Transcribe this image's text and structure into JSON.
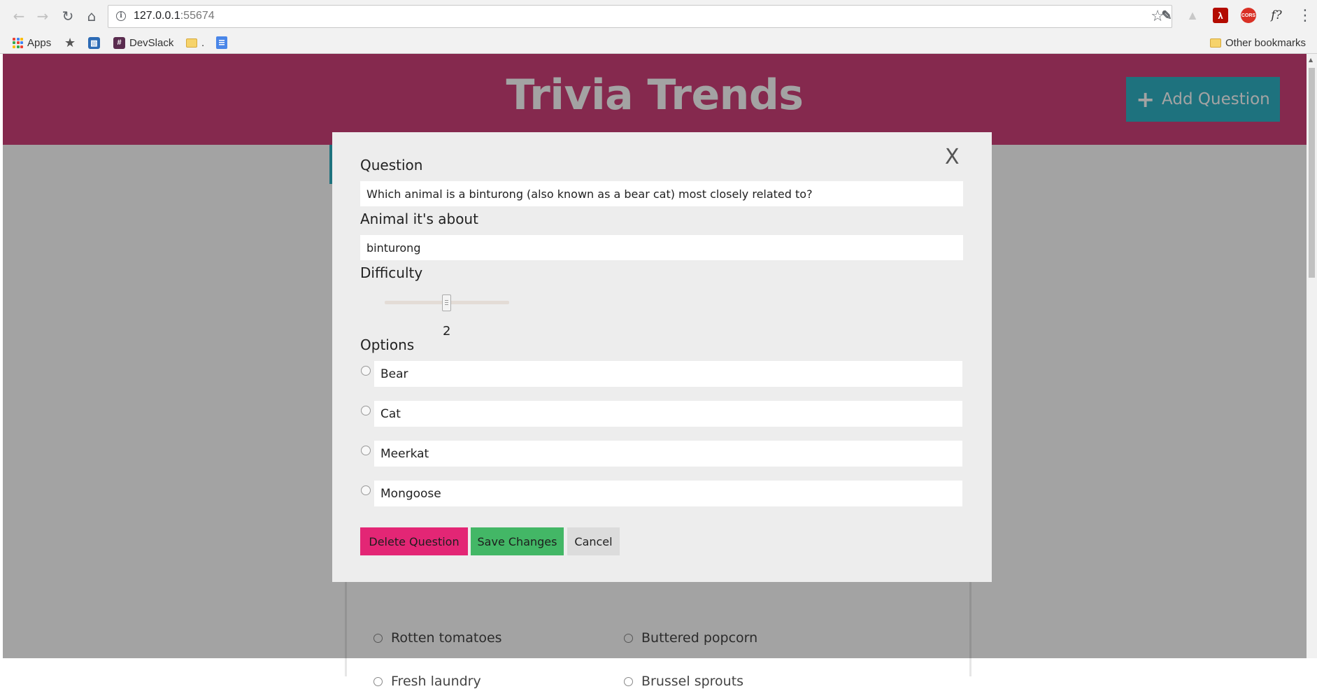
{
  "browser": {
    "url_host": "127.0.0.1",
    "url_port": ":55674",
    "bookmarks": {
      "apps": "Apps",
      "devslack": "DevSlack",
      "dot_folder": ".",
      "other": "Other bookmarks"
    },
    "extensions": [
      "eyedropper-icon",
      "drive-icon",
      "pdf-icon",
      "cors-icon",
      "formula-icon"
    ],
    "ext_labels": {
      "cors": "CORS",
      "formula": "f?"
    }
  },
  "header": {
    "title": "Trivia Trends",
    "add_button": "Add Question",
    "colors": {
      "bar": "#d1417a",
      "button": "#2fb3c6"
    }
  },
  "background_card": {
    "options": [
      "Rotten tomatoes",
      "Buttered popcorn",
      "Fresh laundry",
      "Brussel sprouts"
    ]
  },
  "modal": {
    "close_label": "X",
    "question_label": "Question",
    "question_value": "Which animal is a binturong (also known as a bear cat) most closely related to?",
    "animal_label": "Animal it's about",
    "animal_value": "binturong",
    "difficulty_label": "Difficulty",
    "difficulty_value": "2",
    "options_label": "Options",
    "options": [
      "Bear",
      "Cat",
      "Meerkat",
      "Mongoose"
    ],
    "buttons": {
      "delete": "Delete Question",
      "save": "Save Changes",
      "cancel": "Cancel"
    },
    "colors": {
      "delete": "#e32675",
      "save": "#43b766",
      "cancel": "#dcdcdc"
    }
  }
}
